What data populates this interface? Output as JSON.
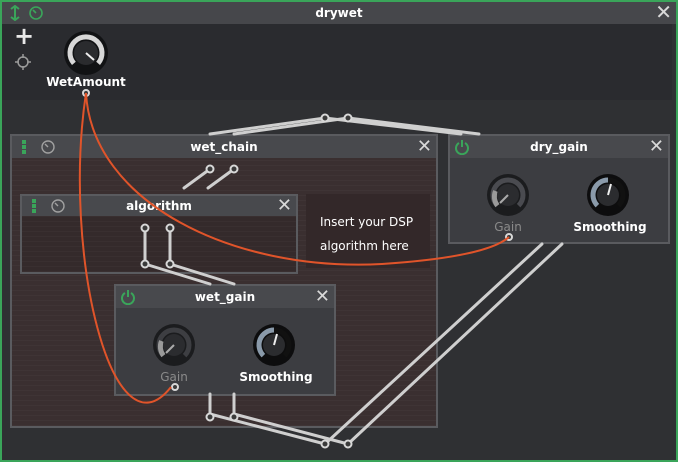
{
  "window": {
    "title": "drywet"
  },
  "toolbar": {
    "add_icon": "plus-icon",
    "target_icon": "crosshair-icon"
  },
  "wet_amount": {
    "label": "WetAmount"
  },
  "wet_chain": {
    "title": "wet_chain"
  },
  "algorithm": {
    "title": "algorithm",
    "note_line1": "Insert your DSP",
    "note_line2": "algorithm here"
  },
  "wet_gain": {
    "title": "wet_gain",
    "gain_label": "Gain",
    "smoothing_label": "Smoothing"
  },
  "dry_gain": {
    "title": "dry_gain",
    "gain_label": "Gain",
    "smoothing_label": "Smoothing"
  },
  "colors": {
    "accent_green": "#3aa55a",
    "modulation_cable": "#e0542a",
    "window_border": "#3aa55a"
  }
}
